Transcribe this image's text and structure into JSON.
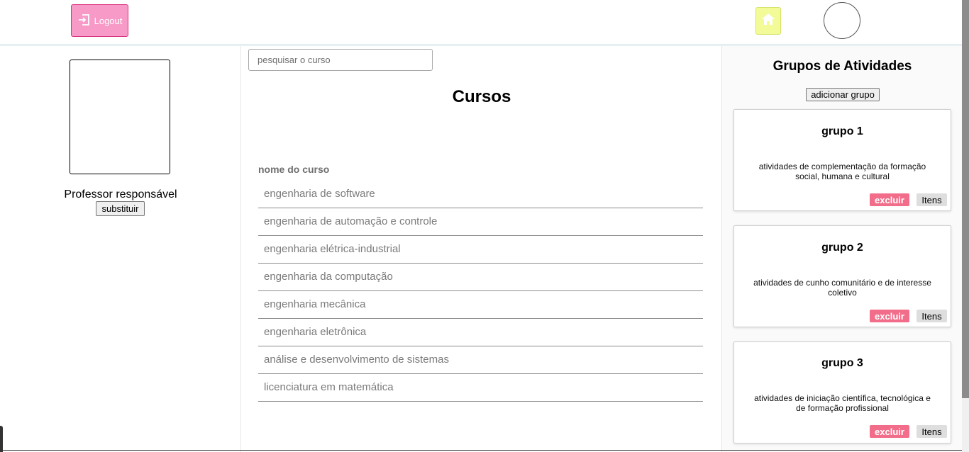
{
  "header": {
    "logout_label": "Logout",
    "logout_icon": "logout-icon",
    "home_icon": "home-icon",
    "accent_logout": "#f79ac7",
    "accent_home": "#f2fb97"
  },
  "left": {
    "professor_label": "Professor responsável",
    "replace_label": "substituir"
  },
  "center": {
    "search_placeholder": "pesquisar o curso",
    "title": "Cursos",
    "column_header": "nome do curso",
    "courses": [
      "engenharia de software",
      "engenharia de automação e controle",
      "engenharia elétrica-industrial",
      "engenharia da computação",
      "engenharia mecânica",
      "engenharia eletrônica",
      "análise e desenvolvimento de sistemas",
      "licenciatura em matemática"
    ]
  },
  "right": {
    "title": "Grupos de Atividades",
    "add_label": "adicionar grupo",
    "groups": [
      {
        "name": "grupo 1",
        "description": "atividades de complementação da formação social, humana e cultural",
        "delete_label": "excluir",
        "items_label": "Itens"
      },
      {
        "name": "grupo 2",
        "description": "atividades de cunho comunitário e de interesse coletivo",
        "delete_label": "excluir",
        "items_label": "Itens"
      },
      {
        "name": "grupo 3",
        "description": "atividades de iniciação científica, tecnológica e de formação profissional",
        "delete_label": "excluir",
        "items_label": "Itens"
      }
    ],
    "accent_delete": "#f26d8a"
  }
}
